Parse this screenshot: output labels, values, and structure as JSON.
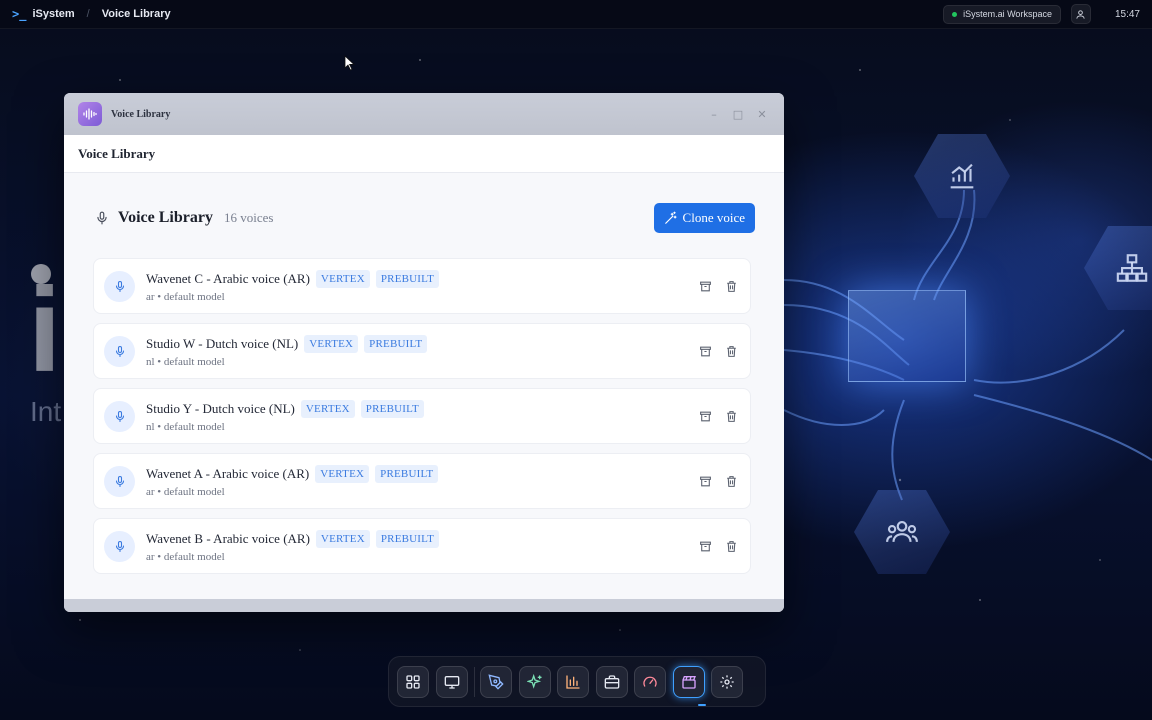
{
  "topbar": {
    "brand": "iSystem",
    "breadcrumb_page": "Voice Library",
    "workspace": "iSystem.ai Workspace",
    "clock": "15:47"
  },
  "background": {
    "letter": "i",
    "subtitle": "Int"
  },
  "window": {
    "title": "Voice Library",
    "header": "Voice Library",
    "library_title": "Voice Library",
    "voice_count": "16 voices",
    "clone_button": "Clone voice",
    "voices": [
      {
        "name": "Wavenet C - Arabic voice (AR)",
        "tags": [
          "VERTEX",
          "PREBUILT"
        ],
        "subtitle": "ar • default model"
      },
      {
        "name": "Studio W - Dutch voice (NL)",
        "tags": [
          "VERTEX",
          "PREBUILT"
        ],
        "subtitle": "nl • default model"
      },
      {
        "name": "Studio Y - Dutch voice (NL)",
        "tags": [
          "VERTEX",
          "PREBUILT"
        ],
        "subtitle": "nl • default model"
      },
      {
        "name": "Wavenet A - Arabic voice (AR)",
        "tags": [
          "VERTEX",
          "PREBUILT"
        ],
        "subtitle": "ar • default model"
      },
      {
        "name": "Wavenet B - Arabic voice (AR)",
        "tags": [
          "VERTEX",
          "PREBUILT"
        ],
        "subtitle": "ar • default model"
      }
    ]
  },
  "dock": {
    "items": [
      {
        "icon": "apps-grid-icon",
        "color": "#e6e9f2"
      },
      {
        "icon": "monitor-icon",
        "color": "#e6e9f2"
      },
      {
        "icon": "pen-tool-icon",
        "color": "#8fb8ff"
      },
      {
        "icon": "sparkles-icon",
        "color": "#7be0b5"
      },
      {
        "icon": "bar-chart-icon",
        "color": "#ffb27a"
      },
      {
        "icon": "briefcase-icon",
        "color": "#e6e9f2"
      },
      {
        "icon": "gauge-icon",
        "color": "#ff8a9a"
      },
      {
        "icon": "clapperboard-icon",
        "color": "#d8a3ff"
      },
      {
        "icon": "gear-icon",
        "color": "#e6e9f2"
      }
    ],
    "active_index": 7
  },
  "colors": {
    "accent": "#1f6fe5",
    "tag_text": "#3b7be0",
    "tag_bg": "#e8f0fd",
    "status_dot": "#22c55e"
  }
}
